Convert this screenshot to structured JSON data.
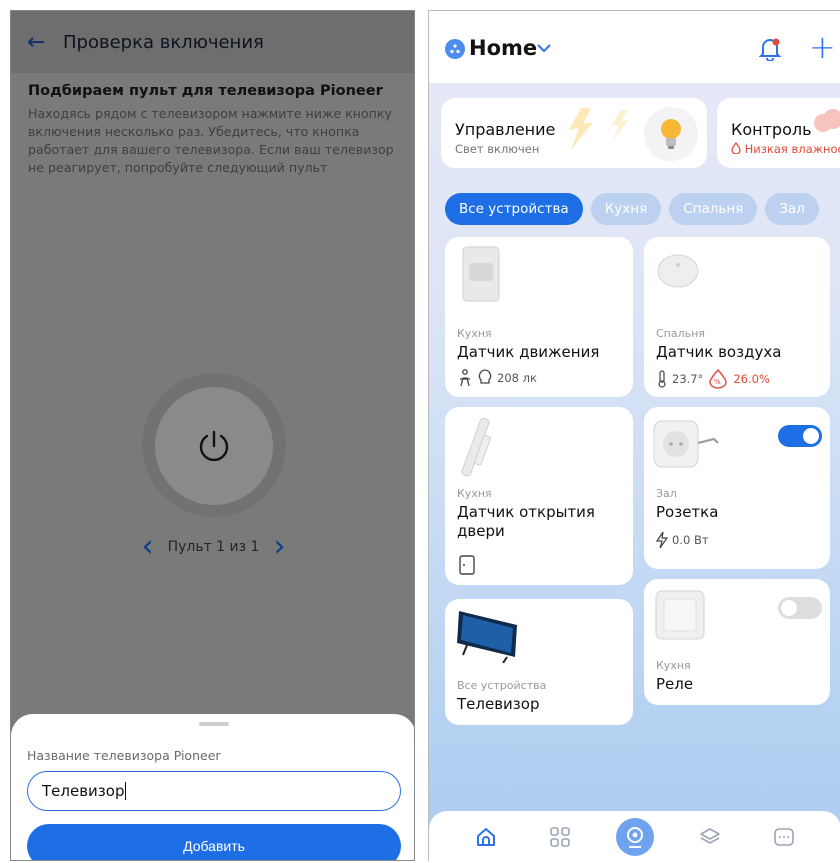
{
  "left": {
    "title": "Проверка включения",
    "heading": "Подбираем пульт для телевизора Pioneer",
    "description": "Находясь рядом с телевизором нажмите ниже кнопку включения несколько раз. Убедитесь, что кнопка работает для вашего телевизора. Если ваш телевизор не реагирует, попробуйте следующий пульт",
    "remote_counter": "Пульт 1 из 1",
    "sheet": {
      "label": "Название телевизора Pioneer",
      "input_value": "Телевизор",
      "button_label": "Добавить"
    }
  },
  "right": {
    "home_title": "Home",
    "summary": [
      {
        "title": "Управление",
        "subtitle": "Свет включен"
      },
      {
        "title": "Контроль",
        "subtitle": "Низкая влажнос"
      }
    ],
    "tabs": [
      "Все устройства",
      "Кухня",
      "Спальня",
      "Зал"
    ],
    "devices": [
      {
        "room": "Кухня",
        "name": "Датчик движения",
        "meta": "208 лк"
      },
      {
        "room": "Спальня",
        "name": "Датчик воздуха",
        "temp": "23.7°",
        "humidity": "26.0%"
      },
      {
        "room": "Кухня",
        "name": "Датчик открытия двери"
      },
      {
        "room": "Зал",
        "name": "Розетка",
        "meta": "0.0 Вт",
        "toggle": "on"
      },
      {
        "room": "Все устройства",
        "name": "Телевизор"
      },
      {
        "room": "Кухня",
        "name": "Реле",
        "toggle": "off"
      }
    ]
  },
  "colors": {
    "accent": "#1e6fe6",
    "alert": "#e24b3a",
    "overlay": "#7a7a7a"
  }
}
